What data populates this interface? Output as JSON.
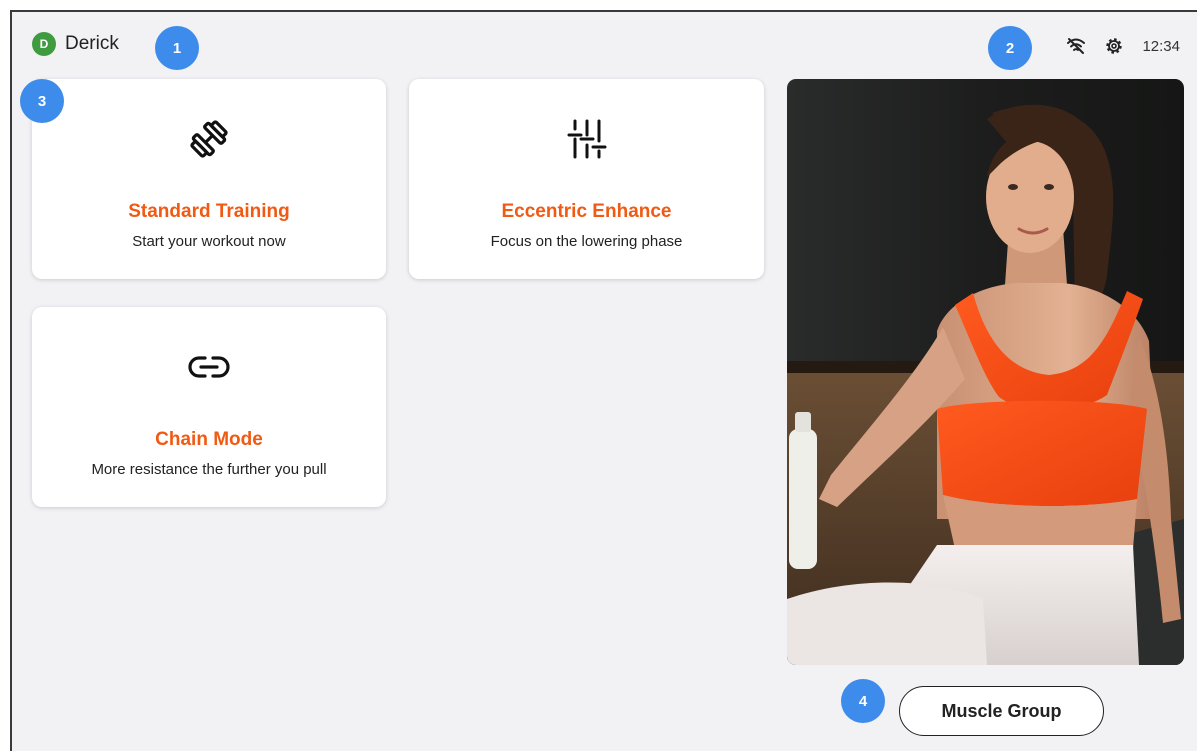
{
  "header": {
    "avatar_initial": "D",
    "user_name": "Derick",
    "time": "12:34",
    "status_icons": [
      "wifi-off-icon",
      "settings-gear-icon"
    ]
  },
  "markers": [
    "1",
    "2",
    "3",
    "4"
  ],
  "modes": [
    {
      "icon": "dumbbell-icon",
      "title": "Standard Training",
      "subtitle": "Start your workout now"
    },
    {
      "icon": "sliders-icon",
      "title": "Eccentric Enhance",
      "subtitle": "Focus on the lowering phase"
    },
    {
      "icon": "link-icon",
      "title": "Chain Mode",
      "subtitle": "More resistance the further you pull"
    }
  ],
  "photo": {
    "subject": "fitness-model-photo"
  },
  "muscle_group_button": "Muscle Group",
  "colors": {
    "accent": "#f05a14",
    "marker": "#3d8bea",
    "avatar": "#3f9b3f",
    "background": "#f2f2f5"
  }
}
